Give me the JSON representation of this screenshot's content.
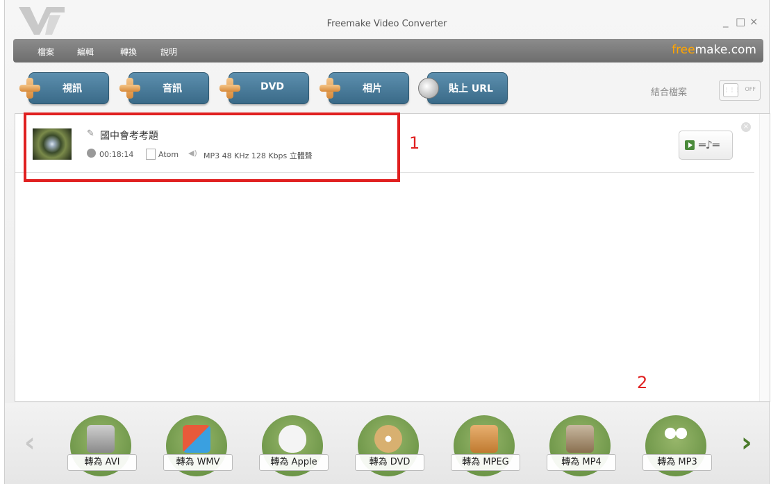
{
  "window": {
    "title": "Freemake Video Converter",
    "minimize": "_",
    "maximize": "□",
    "close": "×"
  },
  "menu": {
    "items": [
      "檔案",
      "編輯",
      "轉換",
      "說明"
    ],
    "brand_accent": "free",
    "brand_rest": "make.com"
  },
  "toolbar": {
    "buttons": [
      "視訊",
      "音訊",
      "DVD",
      "相片",
      "貼上 URL"
    ],
    "join_label": "結合檔案",
    "join_toggle": "OFF"
  },
  "file": {
    "name": "國中會考考題",
    "duration": "00:18:14",
    "video_codec": "Atom",
    "audio_info": "MP3  48 KHz  128 Kbps  立體聲"
  },
  "annotations": {
    "box1": "1",
    "box2": "2"
  },
  "formats": [
    "轉為 AVI",
    "轉為 WMV",
    "轉為 Apple",
    "轉為 DVD",
    "轉為 MPEG",
    "轉為 MP4",
    "轉為 MP3"
  ],
  "nav": {
    "prev": "‹",
    "next": "›"
  }
}
